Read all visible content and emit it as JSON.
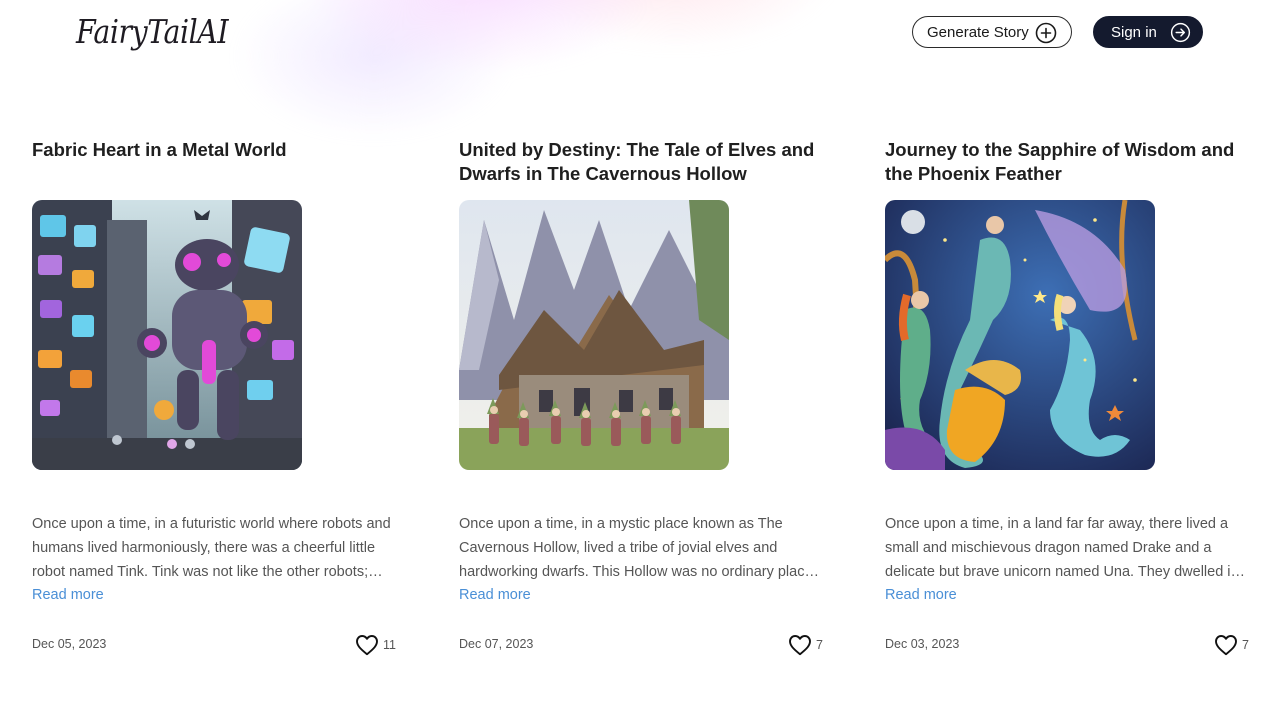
{
  "header": {
    "logo": "FairyTailAI",
    "generate_label": "Generate Story",
    "signin_label": "Sign in"
  },
  "stories": [
    {
      "title": "Fabric Heart in a Metal World",
      "excerpt": "Once upon a time, in a futuristic world where robots and humans lived harmoniously, there was a cheerful little robot named Tink. Tink was not like the other robots; which made him special to everyone in the city.",
      "read_more": "Read more",
      "date": "Dec 05, 2023",
      "likes": "11",
      "image": "robot-city-illustration"
    },
    {
      "title": "United by Destiny: The Tale of Elves and Dwarfs in The Cavernous Hollow",
      "excerpt": "Once upon a time, in a mystic place known as The Cavernous Hollow, lived a tribe of jovial elves and hardworking dwarfs. This Hollow was no ordinary place; it was hidden deep between the mountains.",
      "read_more": "Read more",
      "date": "Dec 07, 2023",
      "likes": "7",
      "image": "elves-cottage-illustration"
    },
    {
      "title": "Journey to the Sapphire of Wisdom and the Phoenix Feather",
      "excerpt": "Once upon a time, in a land far far away, there lived a small and mischievous dragon named Drake and a delicate but brave unicorn named Una. They dwelled in a magical forest full of wonders.",
      "read_more": "Read more",
      "date": "Dec 03, 2023",
      "likes": "7",
      "image": "mermaids-illustration"
    }
  ]
}
